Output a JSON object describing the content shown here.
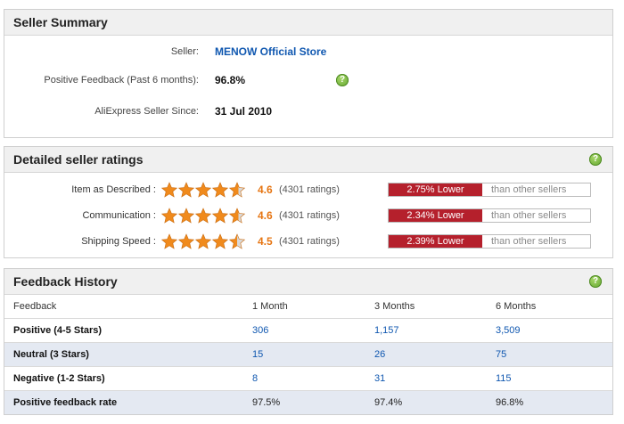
{
  "seller_summary": {
    "title": "Seller Summary",
    "seller_label": "Seller:",
    "seller_name": "MENOW Official Store",
    "feedback_label": "Positive Feedback (Past 6 months):",
    "feedback_value": "96.8%",
    "since_label": "AliExpress Seller Since:",
    "since_value": "31 Jul 2010",
    "help_icon": "help-icon"
  },
  "detailed_ratings": {
    "title": "Detailed seller ratings",
    "rows": [
      {
        "label": "Item as Described :",
        "score": "4.6",
        "count": "(4301 ratings)",
        "stars": 4.6,
        "compare": "2.75% Lower",
        "compare_suffix": "than other sellers"
      },
      {
        "label": "Communication :",
        "score": "4.6",
        "count": "(4301 ratings)",
        "stars": 4.6,
        "compare": "2.34% Lower",
        "compare_suffix": "than other sellers"
      },
      {
        "label": "Shipping Speed :",
        "score": "4.5",
        "count": "(4301 ratings)",
        "stars": 4.5,
        "compare": "2.39% Lower",
        "compare_suffix": "than other sellers"
      }
    ],
    "colors": {
      "star": "#f08a1c",
      "lower": "#b5202c"
    }
  },
  "feedback_history": {
    "title": "Feedback History",
    "headers": [
      "Feedback",
      "1 Month",
      "3 Months",
      "6 Months"
    ],
    "rows": [
      {
        "label": "Positive (4-5 Stars)",
        "values": [
          "306",
          "1,157",
          "3,509"
        ]
      },
      {
        "label": "Neutral (3 Stars)",
        "values": [
          "15",
          "26",
          "75"
        ]
      },
      {
        "label": "Negative (1-2 Stars)",
        "values": [
          "8",
          "31",
          "115"
        ]
      },
      {
        "label": "Positive feedback rate",
        "values": [
          "97.5%",
          "97.4%",
          "96.8%"
        ]
      }
    ]
  }
}
